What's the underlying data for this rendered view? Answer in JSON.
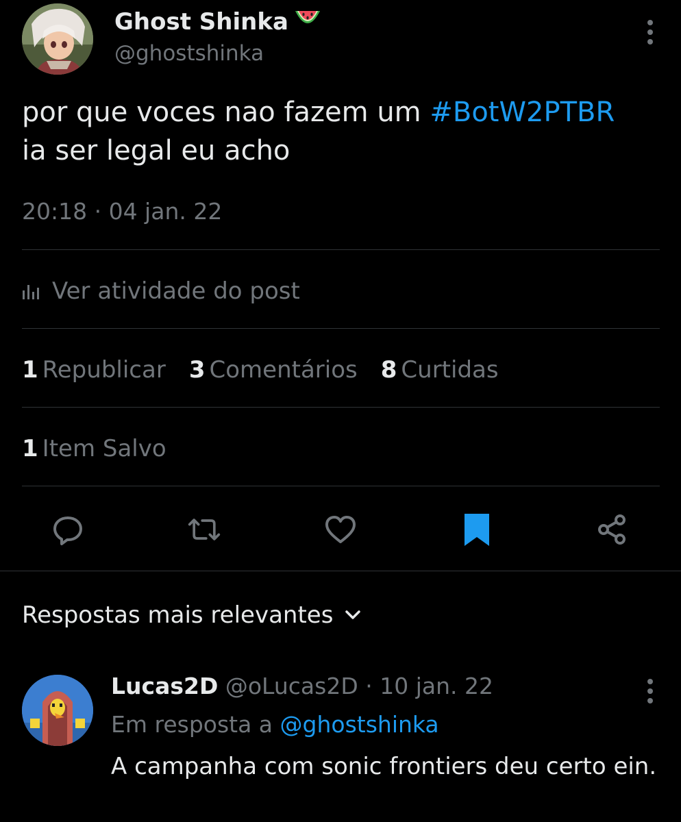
{
  "post": {
    "author_name": "Ghost Shinka",
    "author_handle": "@ghostshinka",
    "text_before": "por que voces nao fazem um ",
    "hashtag": "#BotW2PTBR",
    "text_after": "ia ser legal eu acho",
    "timestamp": "20:18 · 04 jan. 22",
    "activity_label": "Ver atividade do post"
  },
  "stats": {
    "reposts_count": "1",
    "reposts_label": "Republicar",
    "comments_count": "3",
    "comments_label": "Comentários",
    "likes_count": "8",
    "likes_label": "Curtidas",
    "saves_count": "1",
    "saves_label": "Item Salvo"
  },
  "actions": {
    "icons": [
      "reply-icon",
      "repost-icon",
      "like-icon",
      "bookmark-icon",
      "share-icon"
    ],
    "bookmark_active_color": "#1d9bf0"
  },
  "replies": {
    "sort_label": "Respostas mais relevantes",
    "items": [
      {
        "author_name": "Lucas2D",
        "author_handle": "@oLucas2D",
        "date": "· 10 jan. 22",
        "reply_to_prefix": "Em resposta a ",
        "reply_to_handle": "@ghostshinka",
        "text": "A campanha com sonic frontiers deu certo ein."
      }
    ]
  },
  "colors": {
    "background": "#000000",
    "text_primary": "#e7e9ea",
    "text_secondary": "#71767b",
    "accent": "#1d9bf0",
    "divider": "#2f3336"
  }
}
